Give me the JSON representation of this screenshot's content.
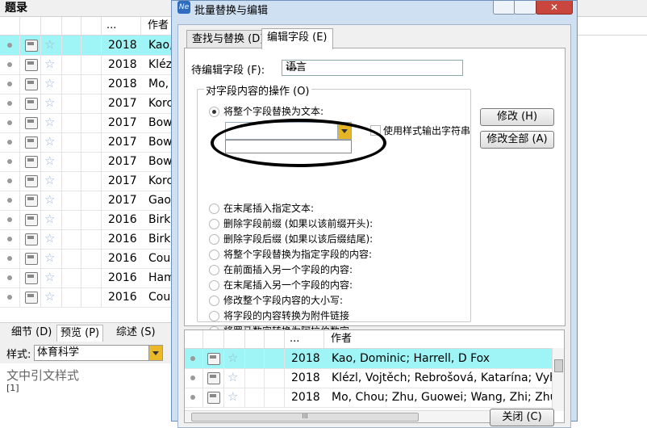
{
  "background": {
    "title": "题录",
    "header": {
      "ellipsis": "...",
      "author_col": "作者"
    },
    "rows": [
      {
        "year": "2018",
        "author": "Kao,",
        "selected": true
      },
      {
        "year": "2018",
        "author": "Klézl",
        "selected": false
      },
      {
        "year": "2018",
        "author": "Mo,",
        "selected": false
      },
      {
        "year": "2017",
        "author": "Korc",
        "selected": false
      },
      {
        "year": "2017",
        "author": "Bow",
        "selected": false
      },
      {
        "year": "2017",
        "author": "Bow",
        "selected": false
      },
      {
        "year": "2017",
        "author": "Bow",
        "selected": false
      },
      {
        "year": "2017",
        "author": "Korc",
        "selected": false
      },
      {
        "year": "2017",
        "author": "Gao,",
        "selected": false
      },
      {
        "year": "2016",
        "author": "Birk,",
        "selected": false
      },
      {
        "year": "2016",
        "author": "Birk,",
        "selected": false
      },
      {
        "year": "2016",
        "author": "Cou",
        "selected": false
      },
      {
        "year": "2016",
        "author": "Ham",
        "selected": false
      },
      {
        "year": "2016",
        "author": "Cou",
        "selected": false
      }
    ],
    "tabs": {
      "details": "细节 (D)",
      "preview": "预览 (P)",
      "summary": "综述 (S)"
    },
    "style_label": "样式:",
    "style_value": "体育科学",
    "preview_text": "文中引文样式",
    "preview_ref": "[1]"
  },
  "dialog": {
    "title": "批量替换与编辑",
    "tabs": {
      "find_replace": "查找与替换 (D)",
      "edit_field": "编辑字段 (E)"
    },
    "field_label": "待编辑字段 (F):",
    "field_value": "语言",
    "field_dots": "...",
    "group_title": "对字段内容的操作 (O)",
    "replace_whole_label": "将整个字段替换为文本:",
    "use_style_label": "使用样式输出字符串",
    "options": [
      "在末尾插入指定文本:",
      "删除字段前缀 (如果以该前缀开头):",
      "删除字段后缀 (如果以该后缀结尾):",
      "将整个字段替换为指定字段的内容:",
      "在前面插入另一个字段的内容:",
      "在末尾插入另一个字段的内容:",
      "修改整个字段内容的大小写:",
      "将字段的内容转换为附件链接",
      "将罗马数字转换为阿拉伯数字"
    ],
    "modify_button": "修改 (H)",
    "modify_all_button": "修改全部 (A)",
    "close_button": "关闭 (C)",
    "list": {
      "ellipsis": "...",
      "author_col": "作者",
      "rows": [
        {
          "year": "2018",
          "author": "Kao, Dominic; Harrell, D Fox",
          "selected": true
        },
        {
          "year": "2018",
          "author": "Klézl, Vojtěch; Rebrošová, Katarína; Vyhlídalov",
          "selected": false
        },
        {
          "year": "2018",
          "author": "Mo, Chou; Zhu, Guowei; Wang, Zhi; Zhu, Wen",
          "selected": false
        }
      ],
      "scroll_marker": "III"
    }
  }
}
